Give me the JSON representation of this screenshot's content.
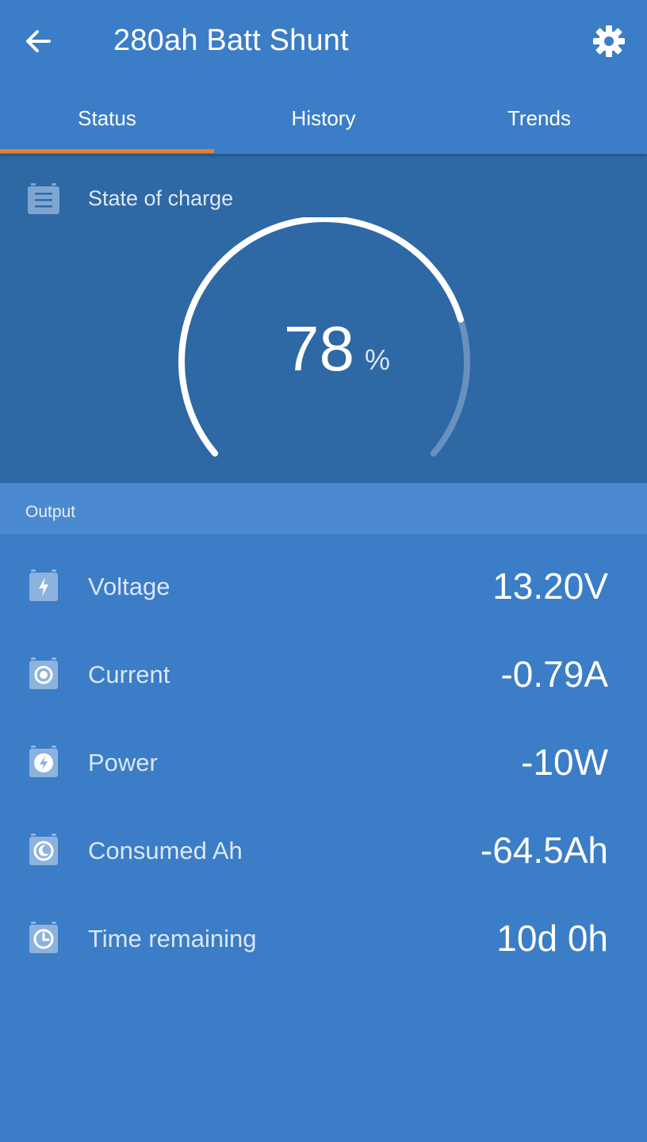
{
  "header": {
    "title": "280ah Batt Shunt",
    "back_icon": "arrow-left-icon",
    "settings_icon": "gear-icon"
  },
  "tabs": [
    {
      "label": "Status",
      "active": true
    },
    {
      "label": "History",
      "active": false
    },
    {
      "label": "Trends",
      "active": false
    }
  ],
  "state_of_charge": {
    "label": "State of charge",
    "value": "78",
    "unit": "%",
    "fraction": 0.78,
    "icon": "list-icon"
  },
  "output": {
    "title": "Output",
    "rows": [
      {
        "label": "Voltage",
        "value": "13.20V",
        "icon": "bolt-icon"
      },
      {
        "label": "Current",
        "value": "-0.79A",
        "icon": "circle-dot-icon"
      },
      {
        "label": "Power",
        "value": "-10W",
        "icon": "power-bolt-icon"
      },
      {
        "label": "Consumed Ah",
        "value": "-64.5Ah",
        "icon": "moon-icon"
      },
      {
        "label": "Time remaining",
        "value": "10d 0h",
        "icon": "clock-icon"
      }
    ]
  },
  "colors": {
    "background": "#3b7dc6",
    "panel": "#2e68a5",
    "section_header": "#4b8ad0",
    "tab_indicator": "#e8802e"
  }
}
